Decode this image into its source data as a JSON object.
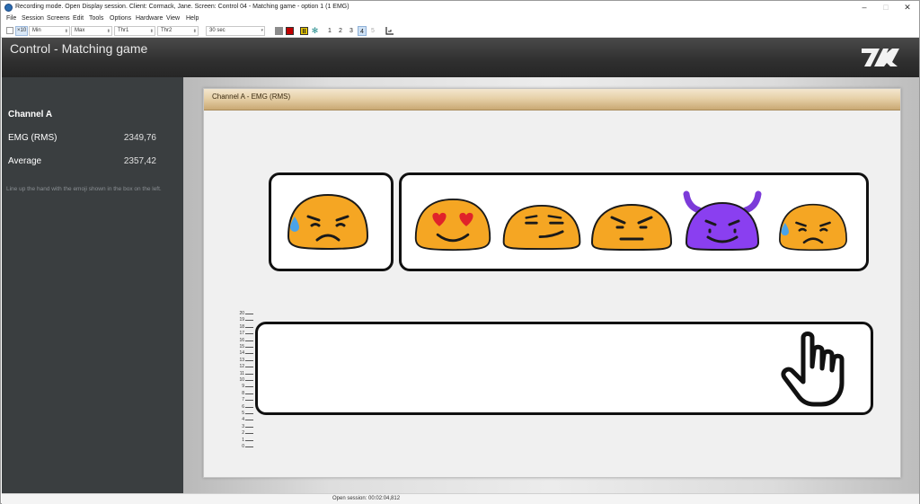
{
  "window": {
    "title": "Recording mode. Open Display session. Client: Cormack, Jane. Screen: Control 04 - Matching game - option 1 (1 EMG)",
    "minimize": "–",
    "maximize": "□",
    "close": "✕"
  },
  "menu": [
    "File",
    "Session",
    "Screens",
    "Edit",
    "Tools",
    "Options",
    "Hardware",
    "View",
    "Help"
  ],
  "toolbar": {
    "zoom_label": "×10",
    "min_label": "Min",
    "max_label": "Max",
    "thr1_label": "Thr1",
    "thr2_label": "Thr2",
    "time_value": "30 sec",
    "nums": [
      "1",
      "2",
      "3",
      "4",
      "5"
    ],
    "colors": {
      "gray": "#8c8c8c",
      "red": "#c00000",
      "yellow": "#e0c000",
      "teal": "#1f8a8a"
    }
  },
  "header": {
    "title": "Control - Matching game"
  },
  "sidebar": {
    "channel": "Channel A",
    "emg_label": "EMG (RMS)",
    "emg_value": "2349,76",
    "avg_label": "Average",
    "avg_value": "2357,42",
    "instruction": "Line up the hand with the emoji shown in the box on the left."
  },
  "panel": {
    "title": "Channel A - EMG (RMS)"
  },
  "emojis": {
    "target": "anxious-sweat-face",
    "options": [
      "heart-eyes-face",
      "smirking-face",
      "angry-face",
      "smiling-devil-face",
      "anxious-sweat-face"
    ]
  },
  "scale": [
    "20",
    "19",
    "18",
    "17",
    "16",
    "15",
    "14",
    "13",
    "12",
    "11",
    "10",
    "9",
    "8",
    "7",
    "6",
    "5",
    "4",
    "3",
    "2",
    "1",
    "0"
  ],
  "status": {
    "text": "Open session: 00:02:04,812"
  }
}
